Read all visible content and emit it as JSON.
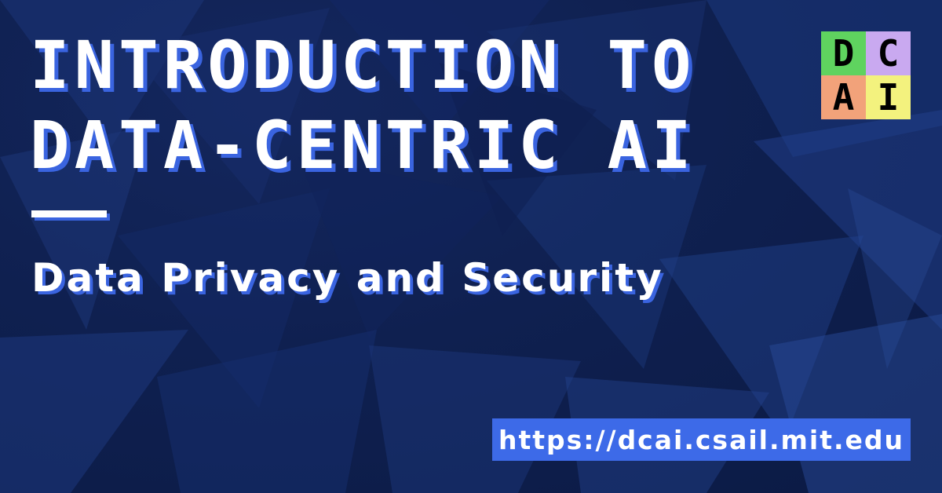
{
  "title": {
    "line1": "INTRODUCTION TO",
    "line2": "DATA-CENTRIC AI"
  },
  "subtitle": "Data Privacy and Security",
  "url": "https://dcai.csail.mit.edu",
  "logo": {
    "cells": [
      {
        "letter": "D",
        "color": "#5fd35f"
      },
      {
        "letter": "C",
        "color": "#c9a9f0"
      },
      {
        "letter": "A",
        "color": "#f2a27a"
      },
      {
        "letter": "I",
        "color": "#f3f27e"
      }
    ]
  },
  "colors": {
    "background": "#0f2050",
    "accent": "#3a64e0",
    "text": "#ffffff",
    "url_box": "#3d6ae8"
  }
}
